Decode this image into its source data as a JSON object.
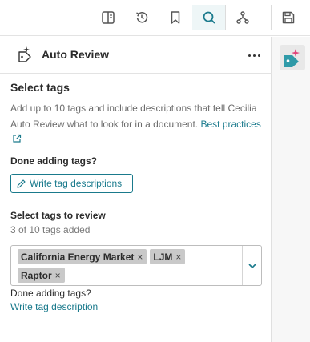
{
  "toolbar": {
    "icons": [
      "book-icon",
      "history-icon",
      "bookmark-icon",
      "search-icon",
      "hierarchy-icon",
      "save-icon"
    ]
  },
  "panel": {
    "title": "Auto Review"
  },
  "select_tags": {
    "heading": "Select tags",
    "description": "Add up to 10 tags and include descriptions that tell Cecilia Auto Review what to look for in a document.",
    "best_practices_label": "Best practices"
  },
  "done_adding": {
    "label": "Done adding tags?",
    "button_label": "Write tag descriptions"
  },
  "review": {
    "heading": "Select tags to review",
    "count_text": "3 of 10 tags added",
    "tags": [
      {
        "label": "California Energy Market"
      },
      {
        "label": "LJM"
      },
      {
        "label": "Raptor"
      }
    ],
    "remove_glyph": "×"
  },
  "footer": {
    "done_label": "Done adding tags?",
    "link_label": "Write tag description"
  },
  "colors": {
    "accent": "#1a7a8c",
    "chip": "#c9c9c9"
  }
}
